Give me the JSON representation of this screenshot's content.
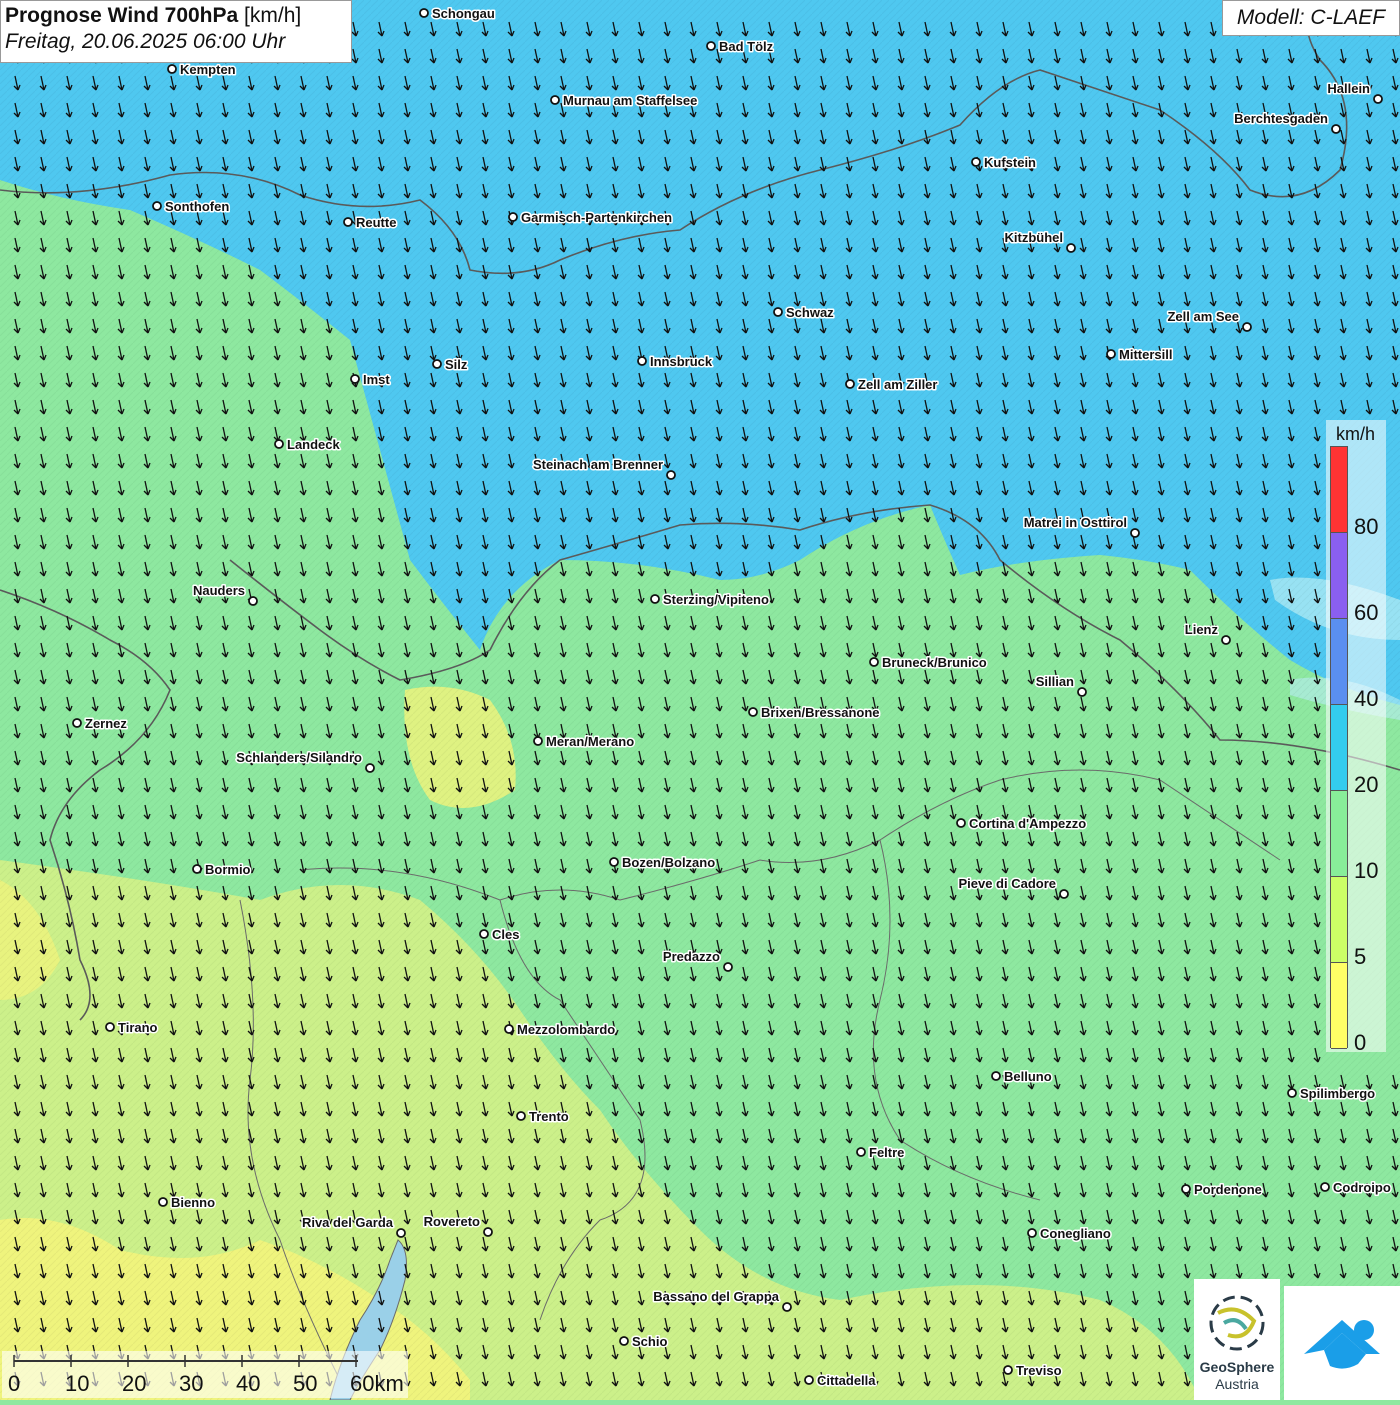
{
  "header": {
    "title_bold": "Prognose Wind 700hPa",
    "title_unit": "[km/h]",
    "datetime": "Freitag, 20.06.2025 06:00 Uhr"
  },
  "model": "Modell: C-LAEF",
  "legend": {
    "unit": "km/h",
    "ticks": [
      "0",
      "5",
      "10",
      "20",
      "40",
      "60",
      "80"
    ],
    "colors": [
      "#ffff66",
      "#ccff66",
      "#88ee99",
      "#33ccee",
      "#5a8ff0",
      "#8a5ff0",
      "#ff3333"
    ]
  },
  "scale_bar": {
    "ticks": [
      "0",
      "10",
      "20",
      "30",
      "40",
      "50",
      "60km"
    ]
  },
  "logos": {
    "geosphere_name": "GeoSphere",
    "geosphere_country": "Austria"
  },
  "colors": {
    "strong_wind": "#4fc8f0",
    "moderate_wind": "#8ee8a0",
    "weak_wind": "#ccf08a",
    "calm": "#f4f47a",
    "arrow": "#111111"
  },
  "wind_field": {
    "direction": "north-westerly flow (arrows pointing south-south-east)"
  },
  "cities": [
    {
      "name": "Schongau"
    },
    {
      "name": "Bad Tölz"
    },
    {
      "name": "Kempten"
    },
    {
      "name": "Murnau am Staffelsee"
    },
    {
      "name": "Hallein"
    },
    {
      "name": "Berchtesgaden"
    },
    {
      "name": "Kufstein"
    },
    {
      "name": "Sonthofen"
    },
    {
      "name": "Reutte"
    },
    {
      "name": "Garmisch-Partenkirchen"
    },
    {
      "name": "Kitzbühel"
    },
    {
      "name": "Schwaz"
    },
    {
      "name": "Zell am See"
    },
    {
      "name": "Mittersill"
    },
    {
      "name": "Innsbruck"
    },
    {
      "name": "Silz"
    },
    {
      "name": "Imst"
    },
    {
      "name": "Zell am Ziller"
    },
    {
      "name": "Landeck"
    },
    {
      "name": "Steinach am Brenner"
    },
    {
      "name": "Matrei in Osttirol"
    },
    {
      "name": "Nauders"
    },
    {
      "name": "Sterzing/Vipiteno"
    },
    {
      "name": "Lienz"
    },
    {
      "name": "Bruneck/Brunico"
    },
    {
      "name": "Sillian"
    },
    {
      "name": "Zernez"
    },
    {
      "name": "Brixen/Bressanone"
    },
    {
      "name": "Meran/Merano"
    },
    {
      "name": "Schlanders/Silandro"
    },
    {
      "name": "Cortina d'Ampezzo"
    },
    {
      "name": "Bozen/Bolzano"
    },
    {
      "name": "Bormio"
    },
    {
      "name": "Pieve di Cadore"
    },
    {
      "name": "Cles"
    },
    {
      "name": "Predazzo"
    },
    {
      "name": "Tirano"
    },
    {
      "name": "Mezzolombardo"
    },
    {
      "name": "Belluno"
    },
    {
      "name": "Spilimbergo"
    },
    {
      "name": "Trento"
    },
    {
      "name": "Feltre"
    },
    {
      "name": "Pordenone"
    },
    {
      "name": "Codroipo"
    },
    {
      "name": "Bienno"
    },
    {
      "name": "Riva del Garda"
    },
    {
      "name": "Rovereto"
    },
    {
      "name": "Conegliano"
    },
    {
      "name": "Bassano del Grappa"
    },
    {
      "name": "Schio"
    },
    {
      "name": "Cittadella"
    },
    {
      "name": "Treviso"
    }
  ]
}
